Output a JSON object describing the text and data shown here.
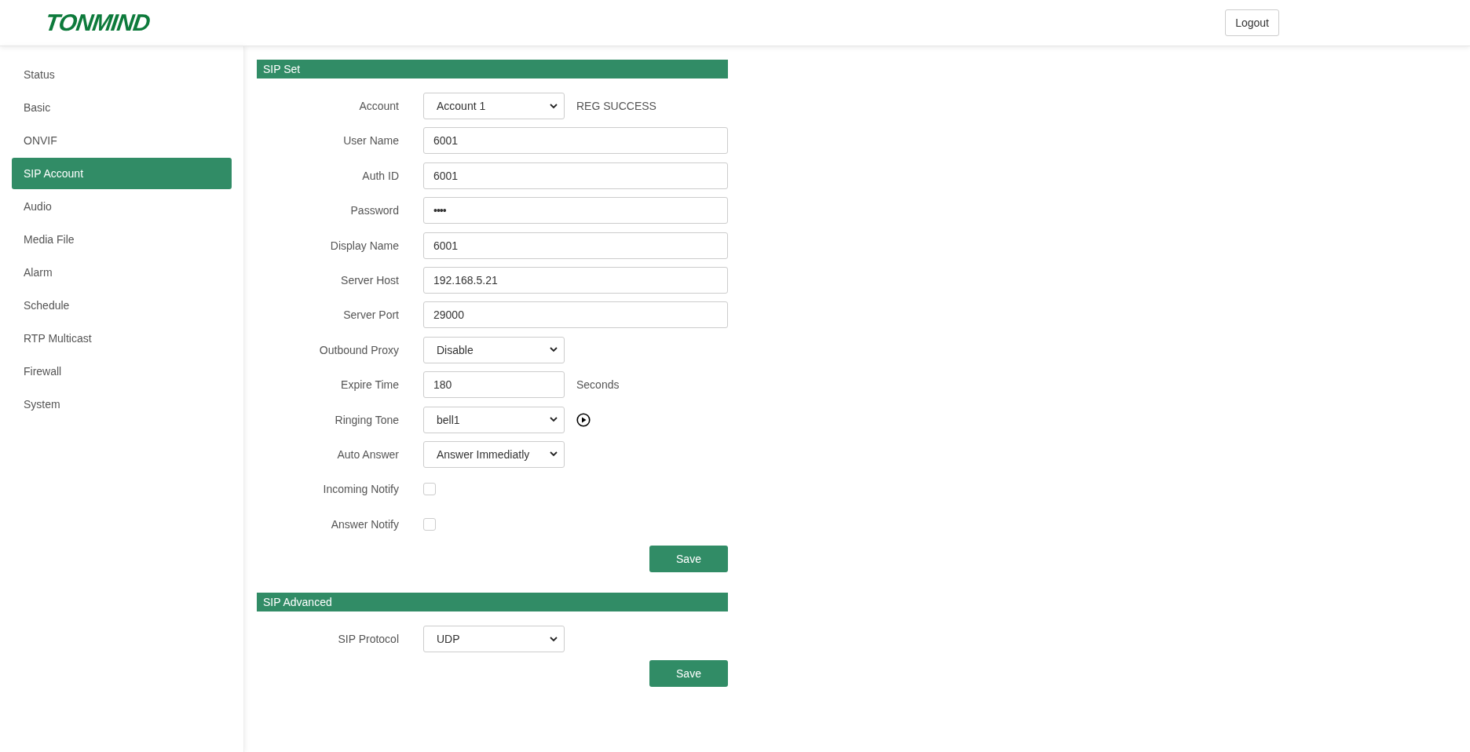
{
  "header": {
    "logo": "TONMIND",
    "logout": "Logout"
  },
  "sidebar": {
    "items": [
      {
        "label": "Status",
        "selected": false
      },
      {
        "label": "Basic",
        "selected": false
      },
      {
        "label": "ONVIF",
        "selected": false
      },
      {
        "label": "SIP Account",
        "selected": true
      },
      {
        "label": "Audio",
        "selected": false
      },
      {
        "label": "Media File",
        "selected": false
      },
      {
        "label": "Alarm",
        "selected": false
      },
      {
        "label": "Schedule",
        "selected": false
      },
      {
        "label": "RTP Multicast",
        "selected": false
      },
      {
        "label": "Firewall",
        "selected": false
      },
      {
        "label": "System",
        "selected": false
      }
    ]
  },
  "sections": [
    {
      "title": "SIP Set",
      "save": "Save",
      "rows": [
        {
          "label": "Account",
          "kind": "select",
          "value": "Account 1",
          "note": "REG SUCCESS"
        },
        {
          "label": "User Name",
          "kind": "text",
          "short": false,
          "value": "6001"
        },
        {
          "label": "Auth ID",
          "kind": "text",
          "short": false,
          "value": "6001"
        },
        {
          "label": "Password",
          "kind": "password",
          "short": false,
          "value": "••••"
        },
        {
          "label": "Display Name",
          "kind": "text",
          "short": false,
          "value": "6001"
        },
        {
          "label": "Server Host",
          "kind": "text",
          "short": false,
          "value": "192.168.5.21"
        },
        {
          "label": "Server Port",
          "kind": "text",
          "short": false,
          "value": "29000"
        },
        {
          "label": "Outbound Proxy",
          "kind": "select",
          "value": "Disable"
        },
        {
          "label": "Expire Time",
          "kind": "text",
          "short": true,
          "value": "180",
          "note": "Seconds"
        },
        {
          "label": "Ringing Tone",
          "kind": "select",
          "value": "bell1",
          "play": true
        },
        {
          "label": "Auto Answer",
          "kind": "select",
          "value": "Answer Immediatly"
        },
        {
          "label": "Incoming Notify",
          "kind": "checkbox",
          "checked": false
        },
        {
          "label": "Answer Notify",
          "kind": "checkbox",
          "checked": false
        }
      ]
    },
    {
      "title": "SIP Advanced",
      "save": "Save",
      "rows": [
        {
          "label": "SIP Protocol",
          "kind": "select",
          "value": "UDP"
        }
      ]
    }
  ]
}
